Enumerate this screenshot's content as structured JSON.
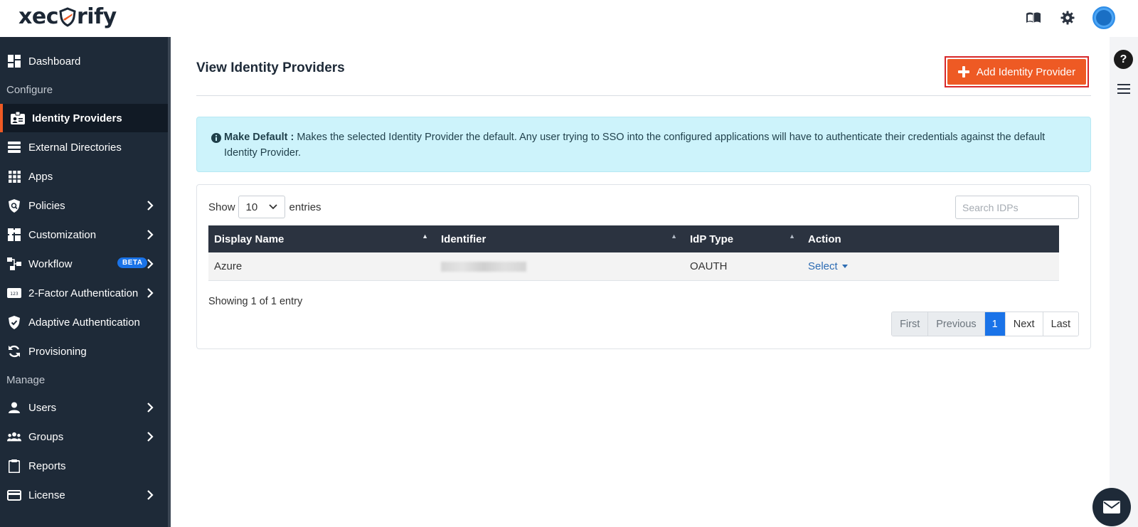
{
  "brand": {
    "logo_prefix": "xec",
    "logo_suffix": "rify",
    "accent": "#ee5a24"
  },
  "topbar": {
    "icons": [
      "book-icon",
      "gear-icon",
      "avatar"
    ]
  },
  "sidebar": {
    "items": [
      {
        "label": "Dashboard",
        "icon": "dashboard-icon"
      },
      {
        "label": "Identity Providers",
        "icon": "id-card-icon",
        "active": true
      },
      {
        "label": "External Directories",
        "icon": "directory-icon"
      },
      {
        "label": "Apps",
        "icon": "apps-grid-icon"
      },
      {
        "label": "Policies",
        "icon": "shield-search-icon",
        "chevron": true
      },
      {
        "label": "Customization",
        "icon": "puzzle-icon",
        "chevron": true
      },
      {
        "label": "Workflow",
        "icon": "workflow-icon",
        "badge": "BETA",
        "chevron": true
      },
      {
        "label": "2-Factor Authentication",
        "icon": "two-factor-icon",
        "chevron": true
      },
      {
        "label": "Adaptive Authentication",
        "icon": "shield-check-icon"
      },
      {
        "label": "Provisioning",
        "icon": "sync-icon"
      },
      {
        "label": "Users",
        "icon": "user-icon",
        "chevron": true
      },
      {
        "label": "Groups",
        "icon": "groups-icon",
        "chevron": true
      },
      {
        "label": "Reports",
        "icon": "clipboard-icon"
      },
      {
        "label": "License",
        "icon": "license-icon",
        "chevron": true
      }
    ],
    "sections": {
      "configure": "Configure",
      "manage": "Manage"
    }
  },
  "main": {
    "title": "View Identity Providers",
    "add_button": "Add Identity Provider",
    "alert": {
      "label": "Make Default :",
      "text": "Makes the selected Identity Provider the default. Any user trying to SSO into the configured applications will have to authenticate their credentials against the default Identity Provider."
    },
    "table": {
      "show_label": "Show",
      "entries_label": "entries",
      "page_length": "10",
      "search_placeholder": "Search IDPs",
      "columns": [
        "Display Name",
        "Identifier",
        "IdP Type",
        "Action"
      ],
      "rows": [
        {
          "display_name": "Azure",
          "identifier": "",
          "idp_type": "OAUTH",
          "action": "Select"
        }
      ],
      "info": "Showing 1 of 1 entry",
      "pagination": [
        "First",
        "Previous",
        "1",
        "Next",
        "Last"
      ]
    }
  },
  "rail": {
    "help": "?"
  }
}
